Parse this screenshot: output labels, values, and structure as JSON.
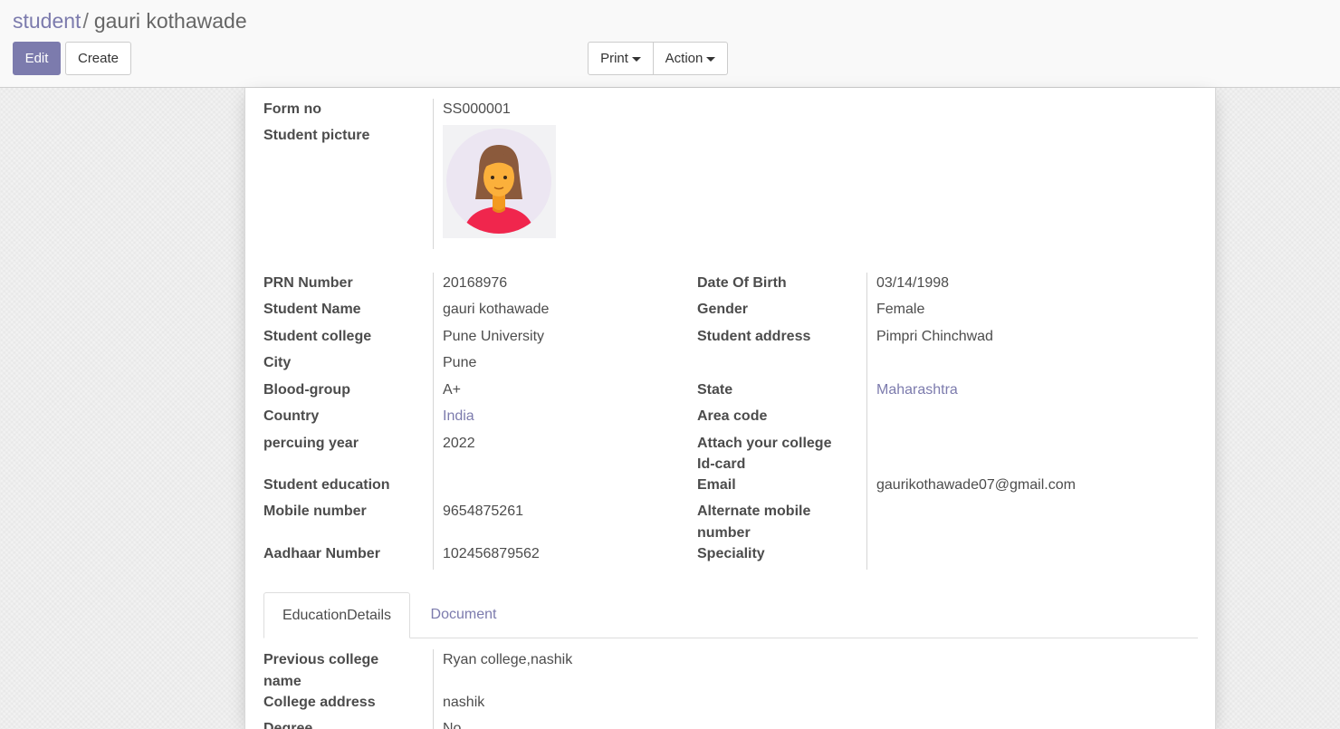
{
  "breadcrumb": {
    "parent": "student",
    "separator": "/",
    "current": "gauri kothawade"
  },
  "buttons": {
    "edit": "Edit",
    "create": "Create",
    "print": "Print",
    "action": "Action"
  },
  "header_fields": {
    "form_no_label": "Form no",
    "form_no_value": "SS000001",
    "picture_label": "Student picture"
  },
  "left_fields": [
    {
      "label": "PRN Number",
      "value": "20168976"
    },
    {
      "label": "Student Name",
      "value": "gauri kothawade"
    },
    {
      "label": "Student college",
      "value": "Pune University"
    },
    {
      "label": "City",
      "value": "Pune"
    },
    {
      "label": "Blood-group",
      "value": "A+"
    },
    {
      "label": "Country",
      "value": "India"
    },
    {
      "label": "percuing year",
      "value": "2022"
    },
    {
      "label": "Student education",
      "value": ""
    },
    {
      "label": "Mobile number",
      "value": "9654875261"
    },
    {
      "label": "Aadhaar Number",
      "value": "102456879562"
    }
  ],
  "right_fields": [
    {
      "label": "Date Of Birth",
      "value": "03/14/1998"
    },
    {
      "label": "Gender",
      "value": "Female"
    },
    {
      "label": "Student address",
      "value": "Pimpri Chinchwad"
    },
    {
      "label": "State",
      "value": "Maharashtra"
    },
    {
      "label": "Area code",
      "value": ""
    },
    {
      "label": "Attach your college",
      "label2": "Id-card",
      "value": ""
    },
    {
      "label": "Email",
      "value": "gaurikothawade07@gmail.com"
    },
    {
      "label": "Alternate mobile",
      "label2": "number",
      "value": ""
    },
    {
      "label": "Speciality",
      "value": ""
    }
  ],
  "tabs": [
    {
      "label": "EducationDetails"
    },
    {
      "label": "Document"
    }
  ],
  "education_fields": [
    {
      "label": "Previous college",
      "label2": "name",
      "value": "Ryan college,nashik"
    },
    {
      "label": "College address",
      "value": "nashik"
    },
    {
      "label": "Degree",
      "value": "No"
    }
  ],
  "colors": {
    "primary": "#7c7bad",
    "avatar_bg": "#ece6f2",
    "hair": "#8b5a3c",
    "skin": "#fbb03b",
    "shirt": "#f0264d"
  },
  "icons": {
    "caret": "caret-down-icon",
    "avatar": "female-avatar-icon"
  }
}
